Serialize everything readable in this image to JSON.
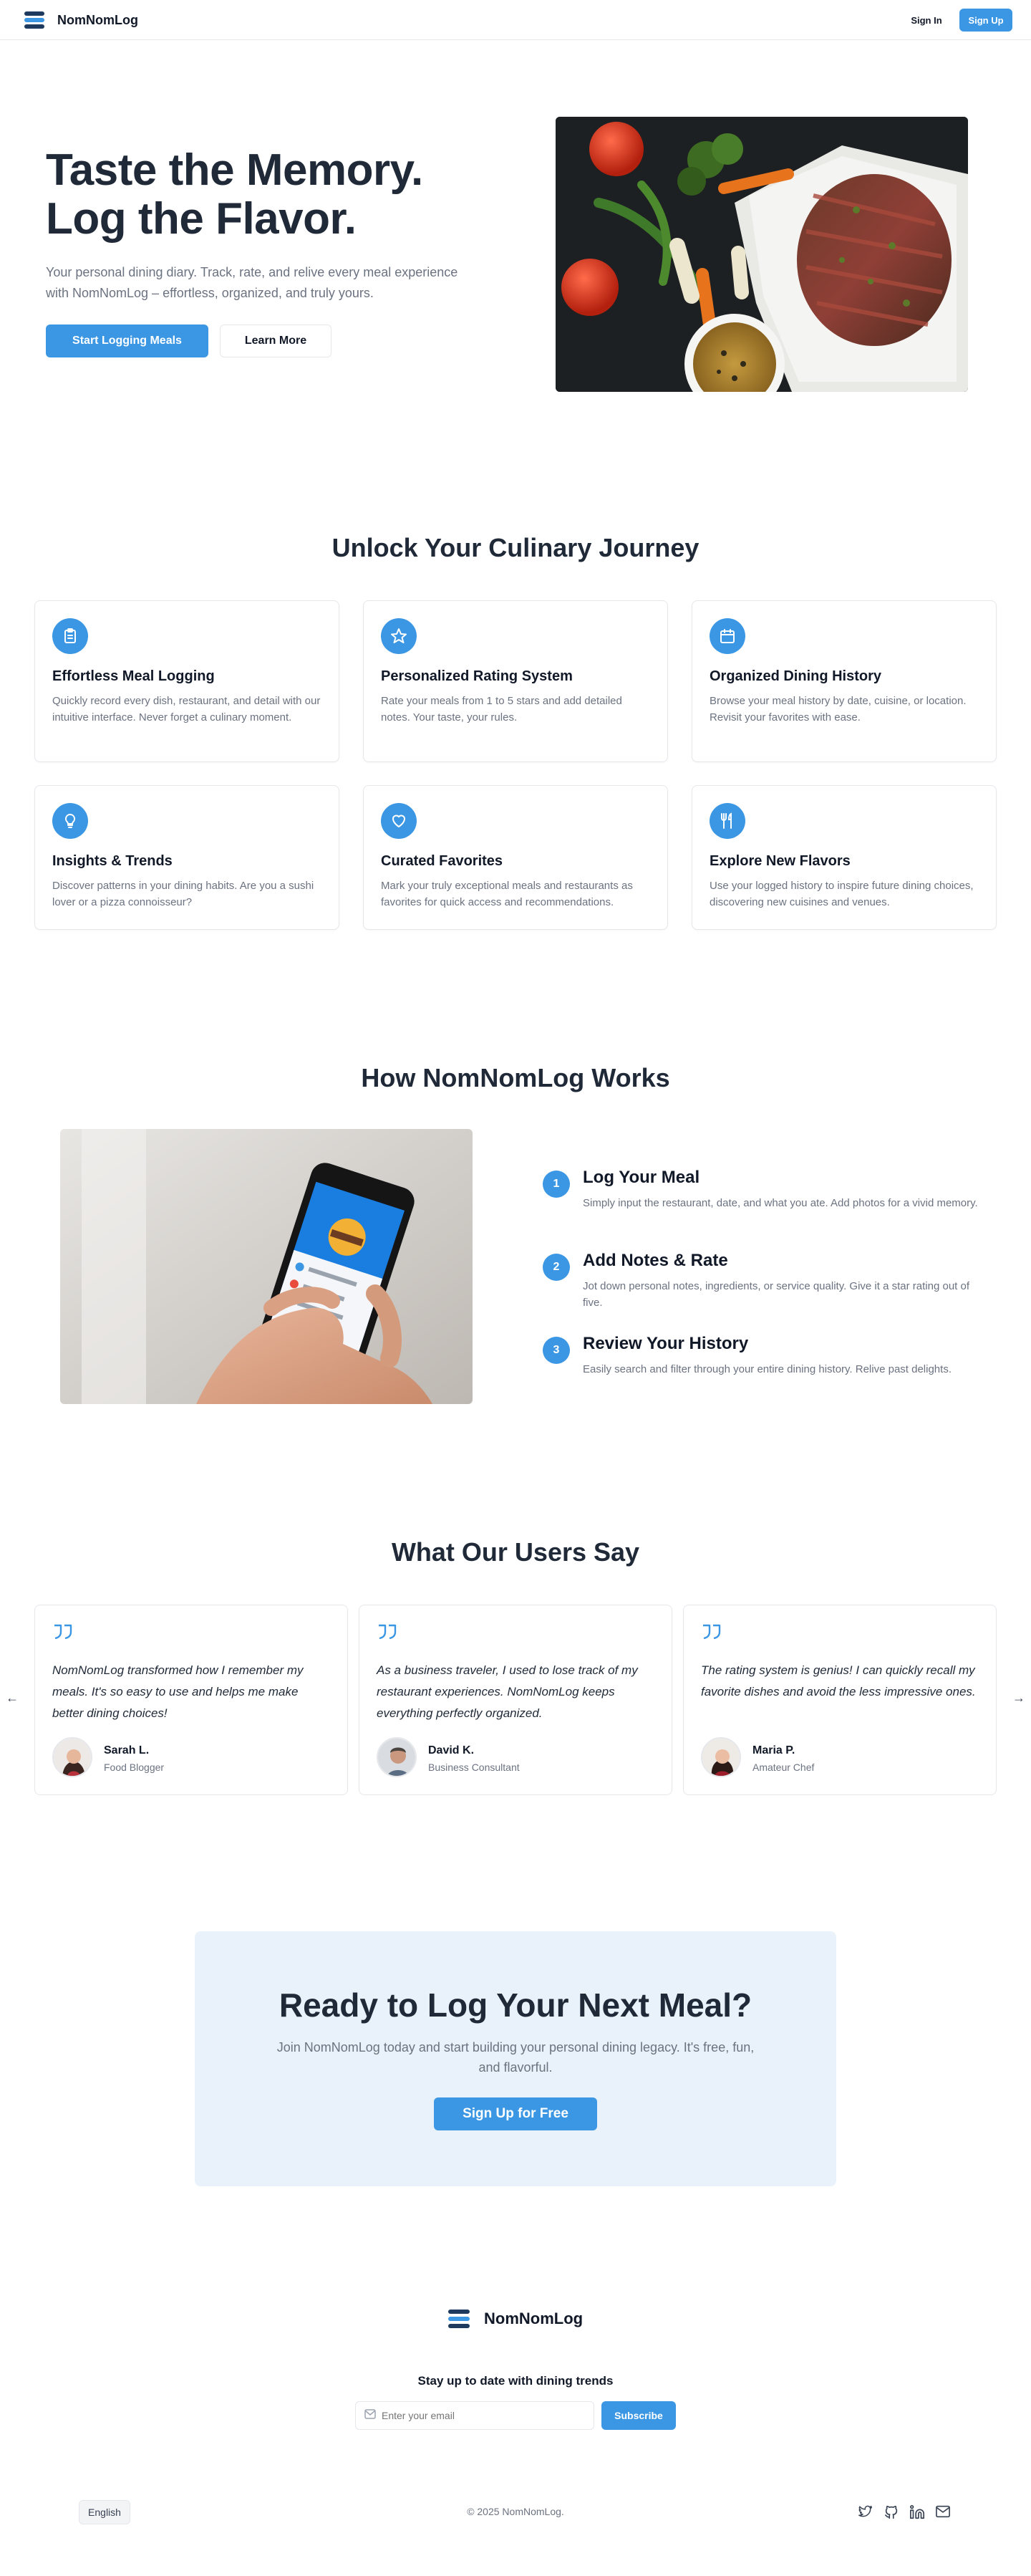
{
  "header": {
    "brand": "NomNomLog",
    "sign_in": "Sign In",
    "sign_up": "Sign Up"
  },
  "hero": {
    "title": "Taste the Memory. Log the Flavor.",
    "subtitle": "Your personal dining diary. Track, rate, and relive every meal experience with NomNomLog – effortless, organized, and truly yours.",
    "primary_cta": "Start Logging Meals",
    "secondary_cta": "Learn More"
  },
  "features": {
    "heading": "Unlock Your Culinary Journey",
    "items": [
      {
        "icon": "clipboard-icon",
        "title": "Effortless Meal Logging",
        "desc": "Quickly record every dish, restaurant, and detail with our intuitive interface. Never forget a culinary moment."
      },
      {
        "icon": "star-icon",
        "title": "Personalized Rating System",
        "desc": "Rate your meals from 1 to 5 stars and add detailed notes. Your taste, your rules."
      },
      {
        "icon": "calendar-icon",
        "title": "Organized Dining History",
        "desc": "Browse your meal history by date, cuisine, or location. Revisit your favorites with ease."
      },
      {
        "icon": "lightbulb-icon",
        "title": "Insights & Trends",
        "desc": "Discover patterns in your dining habits. Are you a sushi lover or a pizza connoisseur?"
      },
      {
        "icon": "heart-icon",
        "title": "Curated Favorites",
        "desc": "Mark your truly exceptional meals and restaurants as favorites for quick access and recommendations."
      },
      {
        "icon": "utensils-icon",
        "title": "Explore New Flavors",
        "desc": "Use your logged history to inspire future dining choices, discovering new cuisines and venues."
      }
    ]
  },
  "how": {
    "heading": "How NomNomLog Works",
    "steps": [
      {
        "num": "1",
        "title": "Log Your Meal",
        "desc": "Simply input the restaurant, date, and what you ate. Add photos for a vivid memory."
      },
      {
        "num": "2",
        "title": "Add Notes & Rate",
        "desc": "Jot down personal notes, ingredients, or service quality. Give it a star rating out of five."
      },
      {
        "num": "3",
        "title": "Review Your History",
        "desc": "Easily search and filter through your entire dining history. Relive past delights."
      }
    ]
  },
  "testimonials": {
    "heading": "What Our Users Say",
    "items": [
      {
        "quote": "NomNomLog transformed how I remember my meals. It's so easy to use and helps me make better dining choices!",
        "name": "Sarah L.",
        "role": "Food Blogger"
      },
      {
        "quote": "As a business traveler, I used to lose track of my restaurant experiences. NomNomLog keeps everything perfectly organized.",
        "name": "David K.",
        "role": "Business Consultant"
      },
      {
        "quote": "The rating system is genius! I can quickly recall my favorite dishes and avoid the less impressive ones.",
        "name": "Maria P.",
        "role": "Amateur Chef"
      }
    ],
    "prev_arrow": "←",
    "next_arrow": "→"
  },
  "cta": {
    "title": "Ready to Log Your Next Meal?",
    "subtitle": "Join NomNomLog today and start building your personal dining legacy. It's free, fun, and flavorful.",
    "button": "Sign Up for Free"
  },
  "footer": {
    "brand": "NomNomLog",
    "newsletter_title": "Stay up to date with dining trends",
    "email_placeholder": "Enter your email",
    "subscribe": "Subscribe",
    "language": "English",
    "copyright": "© 2025 NomNomLog.",
    "social": [
      "twitter-icon",
      "github-icon",
      "linkedin-icon",
      "mail-icon"
    ]
  },
  "colors": {
    "accent": "#3b97e3",
    "logo_dark": "#1e3a5f",
    "cta_bg": "#e9f2fa"
  }
}
